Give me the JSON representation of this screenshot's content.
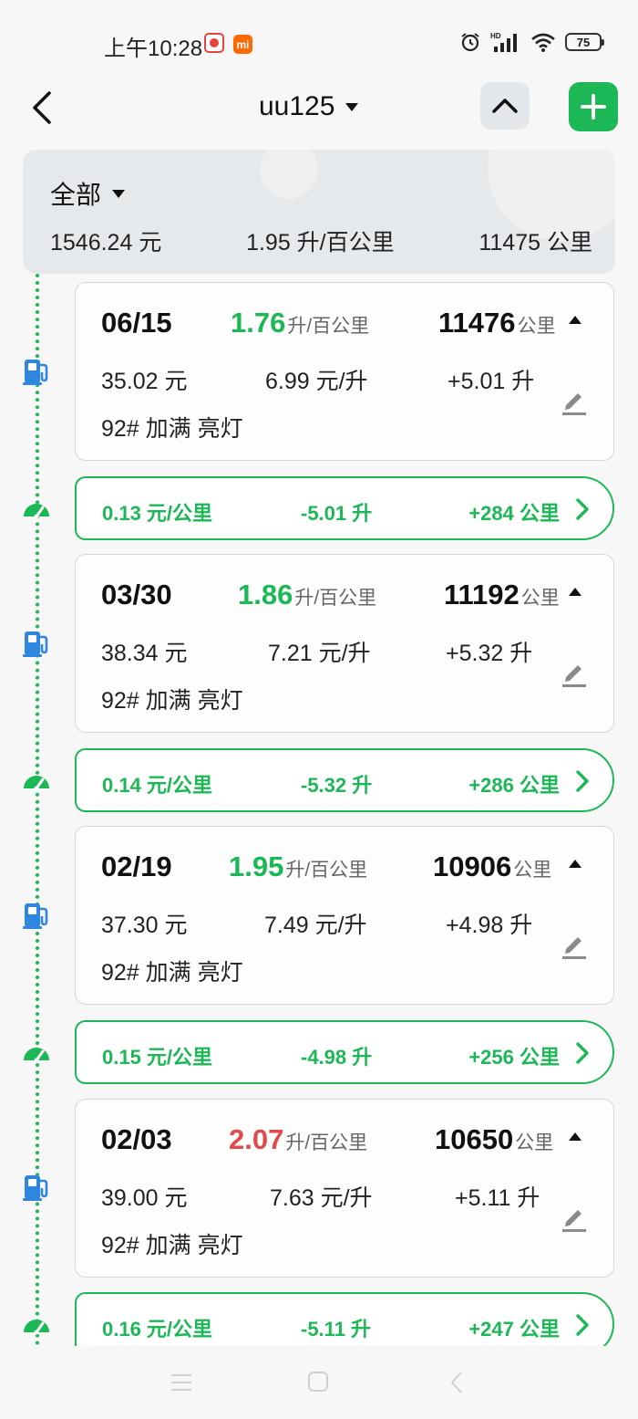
{
  "status_bar": {
    "time": "上午10:28",
    "mi_badge": "mi",
    "battery": "75"
  },
  "nav": {
    "title": "uu125"
  },
  "summary": {
    "filter": "全部",
    "total_cost": "1546.24 元",
    "avg_consumption": "1.95 升/百公里",
    "total_distance": "11475 公里"
  },
  "units": {
    "consumption": "升/百公里",
    "distance": "公里"
  },
  "records": [
    {
      "date": "06/15",
      "consumption": "1.76",
      "consumption_color": "#1db856",
      "odometer": "11476",
      "cost": "35.02 元",
      "price": "6.99 元/升",
      "volume": "+5.01 升",
      "note": "92# 加满 亮灯"
    },
    {
      "date": "03/30",
      "consumption": "1.86",
      "consumption_color": "#1db856",
      "odometer": "11192",
      "cost": "38.34 元",
      "price": "7.21 元/升",
      "volume": "+5.32 升",
      "note": "92# 加满 亮灯"
    },
    {
      "date": "02/19",
      "consumption": "1.95",
      "consumption_color": "#1db856",
      "odometer": "10906",
      "cost": "37.30 元",
      "price": "7.49 元/升",
      "volume": "+4.98 升",
      "note": "92# 加满 亮灯"
    },
    {
      "date": "02/03",
      "consumption": "2.07",
      "consumption_color": "#e24a4a",
      "odometer": "10650",
      "cost": "39.00 元",
      "price": "7.63 元/升",
      "volume": "+5.11 升",
      "note": "92# 加满 亮灯"
    }
  ],
  "intervals": [
    {
      "cost_per_km": "0.13 元/公里",
      "fuel_used": "-5.01 升",
      "distance": "+284 公里"
    },
    {
      "cost_per_km": "0.14 元/公里",
      "fuel_used": "-5.32 升",
      "distance": "+286 公里"
    },
    {
      "cost_per_km": "0.15 元/公里",
      "fuel_used": "-4.98 升",
      "distance": "+256 公里"
    },
    {
      "cost_per_km": "0.16 元/公里",
      "fuel_used": "-5.11 升",
      "distance": "+247 公里"
    }
  ],
  "colors": {
    "accent": "#1db856",
    "warning": "#e24a4a"
  }
}
